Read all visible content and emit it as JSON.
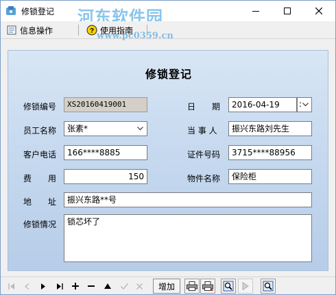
{
  "window": {
    "title": "修锁登记",
    "watermark": "河东软件园",
    "watermark_url": "www.pc0359.cn"
  },
  "menu": {
    "info_label": "信息操作",
    "help_label": "使用指南"
  },
  "form": {
    "title": "修锁登记",
    "lock_no_label": "修锁编号",
    "lock_no_value": "XS20160419001",
    "date_label": "日　　期",
    "date_value": "2016-04-19",
    "date_spin_text": ":",
    "employee_label": "员工名称",
    "employee_value": "张素*",
    "party_label": "当 事 人",
    "party_value": "振兴东路刘先生",
    "phone_label": "客户电话",
    "phone_value": "166****8885",
    "id_label": "证件号码",
    "id_value": "3715****88956",
    "fee_label": "费　　用",
    "fee_value": "150",
    "item_label": "物件名称",
    "item_value": "保险柜",
    "address_label": "地　　址",
    "address_value": "振兴东路**号",
    "repair_label": "修锁情况",
    "repair_value": "锁芯坏了"
  },
  "navigator": {
    "add_label": "增加",
    "first_icon": "first-record-icon",
    "prev_icon": "prev-record-icon",
    "next_icon": "next-record-icon",
    "last_icon": "last-record-icon",
    "insert_icon": "plus-icon",
    "delete_icon": "minus-icon",
    "edit_icon": "up-triangle-icon",
    "post_icon": "check-icon",
    "cancel_icon": "x-icon",
    "print_icon": "printer-icon",
    "preview_icon": "print-preview-icon",
    "search_icon": "magnifier-icon",
    "play_icon": "play-icon",
    "zoom_icon": "zoom-icon"
  },
  "colors": {
    "form_top": "#d8e6f5",
    "form_bottom": "#b7cde8",
    "watermark": "#2896dc"
  }
}
